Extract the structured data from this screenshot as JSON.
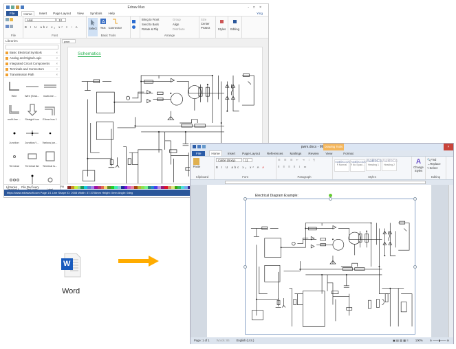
{
  "edraw": {
    "title": "Edraw Max",
    "user": "Ying",
    "tabs": [
      "File",
      "Home",
      "Insert",
      "Page Layout",
      "View",
      "Symbols",
      "Help"
    ],
    "ribbon": {
      "font_name": "Arial",
      "font_size": "10",
      "groups": [
        "File",
        "Font",
        "Basic Tools",
        "Arrange",
        "Styles",
        "Editing"
      ],
      "tools": [
        "Select",
        "Text",
        "Connector"
      ],
      "arrange": [
        "Bring to Front",
        "Send to Back",
        "Rotate & Flip",
        "Group",
        "Align",
        "Distribute",
        "Size",
        "Center",
        "Protect"
      ],
      "styles_label": "Styles",
      "editing_label": "Editing"
    },
    "libraries": {
      "title": "Libraries",
      "categories": [
        "Basic Electrical Symbols",
        "Analog and Digital Logic",
        "Integrated Circuit Components",
        "Terminals and Connectors",
        "Transmission Path"
      ],
      "shapes": [
        "Wire",
        "Wire (Strai...",
        "multi-line ...",
        "multi-line ...",
        "Straight bus",
        "Elbow bus 1",
        "Junction",
        "Junction/ i...",
        "Various jun...",
        "Terminal",
        "Terminal list",
        "Terminal ls...",
        "Terminal li...",
        "Test point",
        "Label"
      ],
      "footer_tabs": [
        "Libraries",
        "File Recovery"
      ]
    },
    "doc_tab": "pwm",
    "schematic_title": "Schematics",
    "palette_label": "Fill",
    "status": "https://www.edrawsoft.com   Page 1/1   Line   Shape ID: 2008   Width: 37.3708mm   Height: 0mm   Angle: 0deg",
    "window_controls": [
      "-",
      "□",
      "×"
    ]
  },
  "word": {
    "title": "pwm.docx - Microsoft Word",
    "contextual_tab": "Drawing Tools",
    "tabs": [
      "File",
      "Home",
      "Insert",
      "Page Layout",
      "References",
      "Mailings",
      "Review",
      "View",
      "Format"
    ],
    "ribbon": {
      "font_name": "Calibri (Body)",
      "font_size": "11",
      "groups": [
        "Clipboard",
        "Font",
        "Paragraph",
        "Styles",
        "Editing"
      ],
      "paste": "Paste",
      "styles": [
        {
          "sample": "AaBbCcDc",
          "name": "¶ Normal"
        },
        {
          "sample": "AaBbCcDc",
          "name": "¶ No Spaci..."
        },
        {
          "sample": "AaBbCc",
          "name": "Heading 1"
        },
        {
          "sample": "AaBbCc",
          "name": "Heading 2"
        }
      ],
      "change_styles": "Change Styles",
      "editing": [
        "Find",
        "Replace",
        "Select"
      ]
    },
    "caption": "Electrical Diagram Example:",
    "status": {
      "page": "Page: 1 of 1",
      "words": "Words: 86",
      "language": "English (U.S.)",
      "zoom": "100%"
    }
  },
  "word_icon": {
    "label": "Word",
    "glyph": "W"
  },
  "colors": {
    "arrow": "#ffac00",
    "edraw_blue": "#2b579a",
    "word_blue": "#185abd",
    "schematic_green": "#22b14c"
  }
}
